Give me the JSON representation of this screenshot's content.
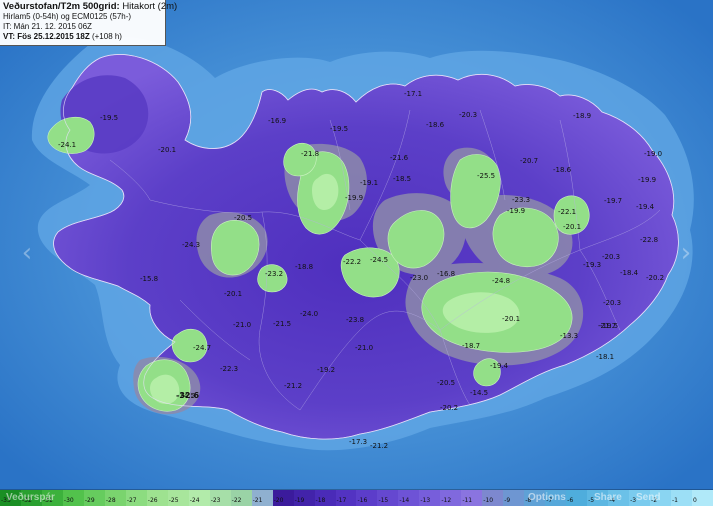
{
  "info": {
    "title_main": "Veðurstofan/T2m 500grid:",
    "title_sub": "Hitakort (2m)",
    "models": "Hirlam5 (0-54h) og ECM0125 (57h-)",
    "issued": "IT: Mán 21. 12. 2015 06Z",
    "valid_label": "VT: Fös 25.12.2015 18Z",
    "valid_offset": "(+108 h)"
  },
  "nav": {
    "prev_icon": "chevron-left-icon",
    "next_icon": "chevron-right-icon"
  },
  "colors": {
    "sea_deep": "#2f7fd0",
    "sea_shelf": "#4f97db",
    "land_dark_purple": "#5b3fc6",
    "land_purple": "#6a4fd3",
    "land_violet": "#8a6fe0",
    "gray_band": "#8f8ca8",
    "cold_green": "#8fe08a",
    "coldest_green": "#b6f2a8"
  },
  "temperature_labels": [
    "-17.1",
    "-19.5",
    "-18.6",
    "-20.3",
    "-18.9",
    "-16.9",
    "-19.5",
    "-24.1",
    "-20.1",
    "-21.6",
    "-21.8",
    "-19.0",
    "-20.7",
    "-18.5",
    "-19.1",
    "-19.9",
    "-25.5",
    "-18.6",
    "-19.7",
    "-19.9",
    "-20.5",
    "-23.3",
    "-24.3",
    "-22.1",
    "-23.2",
    "-18.8",
    "-24.0",
    "-22.2",
    "-20.1",
    "-24.5",
    "-23.0",
    "-23.8",
    "-16.8",
    "-24.8",
    "-19.3",
    "-18.4",
    "-21.0",
    "-21.5",
    "-20.3",
    "-21.7",
    "-19.2",
    "-24.7",
    "-22.3",
    "-21.0",
    "-21.2",
    "-20.5",
    "-14.5",
    "-19.4",
    "-24.5",
    "-19.5",
    "-19.9",
    "-15.8",
    "-22.8",
    "-21.2",
    "-18.7",
    "-20.1",
    "-20.2",
    "-20.3",
    "-13.3",
    "-32.6",
    "-20.2",
    "-17.3",
    "-18.1",
    "-19.4",
    "-20.1"
  ],
  "legend": {
    "values": [
      "-33",
      "-32",
      "-31",
      "-30",
      "-29",
      "-28",
      "-27",
      "-26",
      "-25",
      "-24",
      "-23",
      "-22",
      "-21",
      "-20",
      "-19",
      "-18",
      "-17",
      "-16",
      "-15",
      "-14",
      "-13",
      "-12",
      "-11",
      "-10",
      "-9",
      "-8",
      "-7",
      "-6",
      "-5",
      "-4",
      "-3",
      "-2",
      "-1",
      "0"
    ],
    "colors": [
      "#1a8f24",
      "#2aa030",
      "#3cb13c",
      "#52c24c",
      "#66cc5e",
      "#7ad46e",
      "#8cdc80",
      "#9ee290",
      "#a8e69c",
      "#b2ebaa",
      "#a6dfa8",
      "#9ad3a6",
      "#8fb0d0",
      "#3b1b9c",
      "#4223aa",
      "#4a2bb8",
      "#5333c2",
      "#5c3dca",
      "#6548d0",
      "#6e53d6",
      "#775edb",
      "#8069de",
      "#8a74e0",
      "#7d88cf",
      "#6e96d2",
      "#5fa1d6",
      "#56a8da",
      "#4faddc",
      "#5db7e2",
      "#6bc1e8",
      "#7acbee",
      "#8ad5f2",
      "#9cdff6",
      "#b0e9f9"
    ],
    "overlay_left": "Veðurspár",
    "overlay_mid": "Options",
    "overlay_right_1": "Share",
    "overlay_right_2": "Send"
  }
}
